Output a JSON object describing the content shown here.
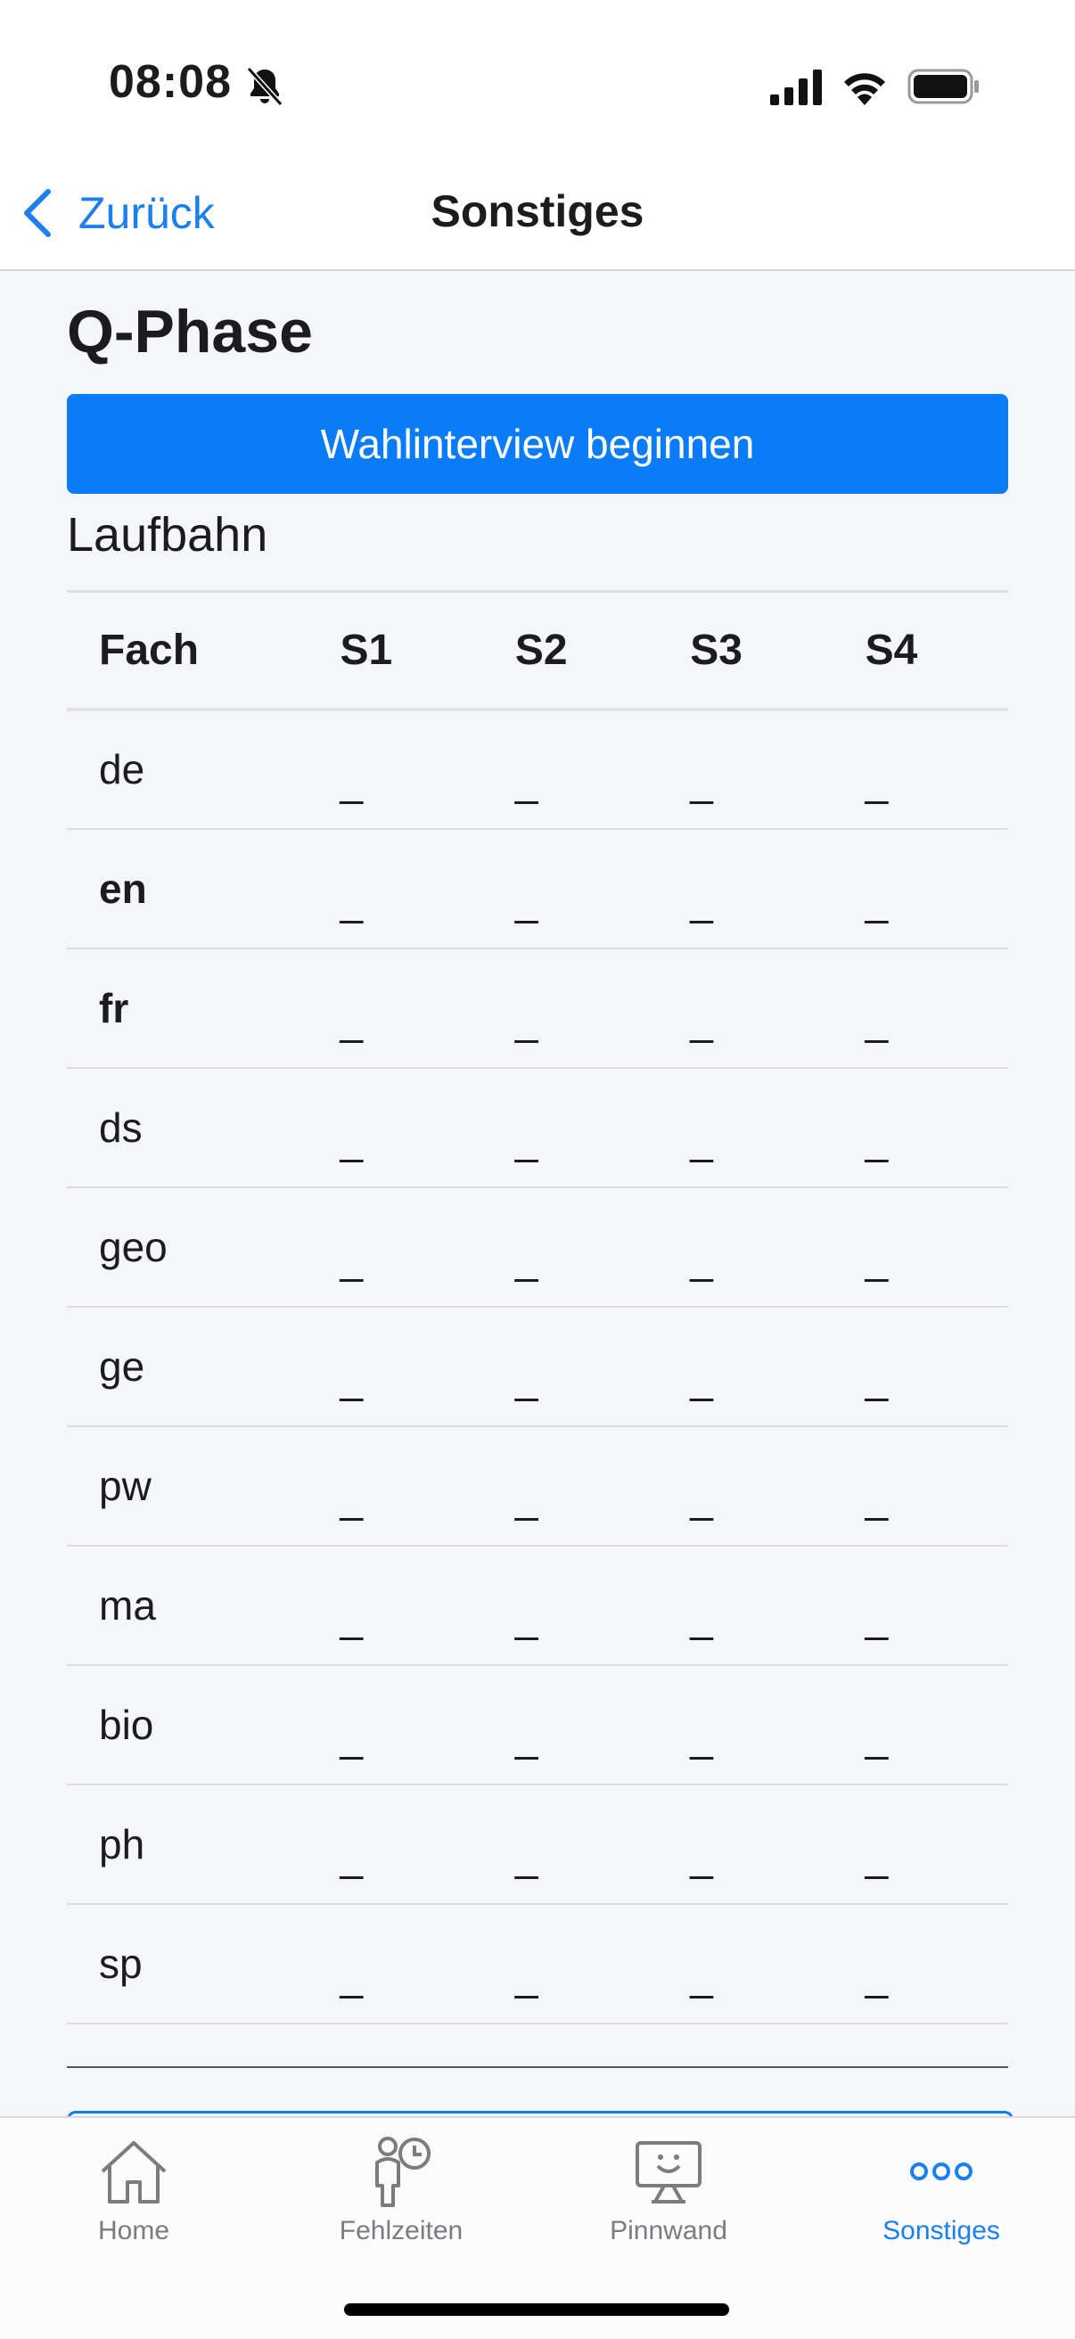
{
  "status_bar": {
    "time": "08:08"
  },
  "nav": {
    "back_label": "Zurück",
    "title": "Sonstiges"
  },
  "main": {
    "heading": "Q-Phase",
    "primary_button": "Wahlinterview beginnen",
    "section_title": "Laufbahn",
    "table": {
      "columns": [
        "Fach",
        "S1",
        "S2",
        "S3",
        "S4"
      ],
      "rows": [
        {
          "fach": "de",
          "bold": false,
          "s1": "_",
          "s2": "_",
          "s3": "_",
          "s4": "_"
        },
        {
          "fach": "en",
          "bold": true,
          "s1": "_",
          "s2": "_",
          "s3": "_",
          "s4": "_"
        },
        {
          "fach": "fr",
          "bold": true,
          "s1": "_",
          "s2": "_",
          "s3": "_",
          "s4": "_"
        },
        {
          "fach": "ds",
          "bold": false,
          "s1": "_",
          "s2": "_",
          "s3": "_",
          "s4": "_"
        },
        {
          "fach": "geo",
          "bold": false,
          "s1": "_",
          "s2": "_",
          "s3": "_",
          "s4": "_"
        },
        {
          "fach": "ge",
          "bold": false,
          "s1": "_",
          "s2": "_",
          "s3": "_",
          "s4": "_"
        },
        {
          "fach": "pw",
          "bold": false,
          "s1": "_",
          "s2": "_",
          "s3": "_",
          "s4": "_"
        },
        {
          "fach": "ma",
          "bold": false,
          "s1": "_",
          "s2": "_",
          "s3": "_",
          "s4": "_"
        },
        {
          "fach": "bio",
          "bold": false,
          "s1": "_",
          "s2": "_",
          "s3": "_",
          "s4": "_"
        },
        {
          "fach": "ph",
          "bold": false,
          "s1": "_",
          "s2": "_",
          "s3": "_",
          "s4": "_"
        },
        {
          "fach": "sp",
          "bold": false,
          "s1": "_",
          "s2": "_",
          "s3": "_",
          "s4": "_"
        }
      ]
    }
  },
  "tab_bar": {
    "tabs": [
      {
        "label": "Home",
        "icon": "house-icon",
        "active": false
      },
      {
        "label": "Fehlzeiten",
        "icon": "person-clock-icon",
        "active": false
      },
      {
        "label": "Pinnwand",
        "icon": "monitor-smiley-icon",
        "active": false
      },
      {
        "label": "Sonstiges",
        "icon": "more-dots-icon",
        "active": true
      }
    ]
  },
  "colors": {
    "accent": "#0a7cf7",
    "background": "#f5f6f8",
    "tab_inactive": "#7b7b80"
  }
}
